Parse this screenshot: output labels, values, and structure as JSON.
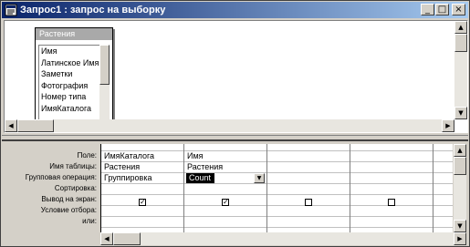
{
  "window": {
    "title": "Запрос1 : запрос на выборку"
  },
  "table": {
    "title": "Растения",
    "fields": [
      "Имя",
      "Латинское Имя",
      "Заметки",
      "Фотография",
      "Номер типа",
      "ИмяКаталога"
    ]
  },
  "grid": {
    "row_labels": [
      "Поле:",
      "Имя таблицы:",
      "Групповая операция:",
      "Сортировка:",
      "Вывод на экран:",
      "Условие отбора:",
      "или:"
    ],
    "columns": [
      {
        "field": "ИмяКаталога",
        "table": "Растения",
        "group": "Группировка",
        "show": true
      },
      {
        "field": "Имя",
        "table": "Растения",
        "group": "Count",
        "show": true
      },
      {
        "field": "",
        "table": "",
        "group": "",
        "show": false
      },
      {
        "field": "",
        "table": "",
        "group": "",
        "show": false
      }
    ]
  },
  "icons": {
    "minimize": "minimize-icon",
    "maximize": "maximize-icon",
    "close": "close-icon"
  }
}
